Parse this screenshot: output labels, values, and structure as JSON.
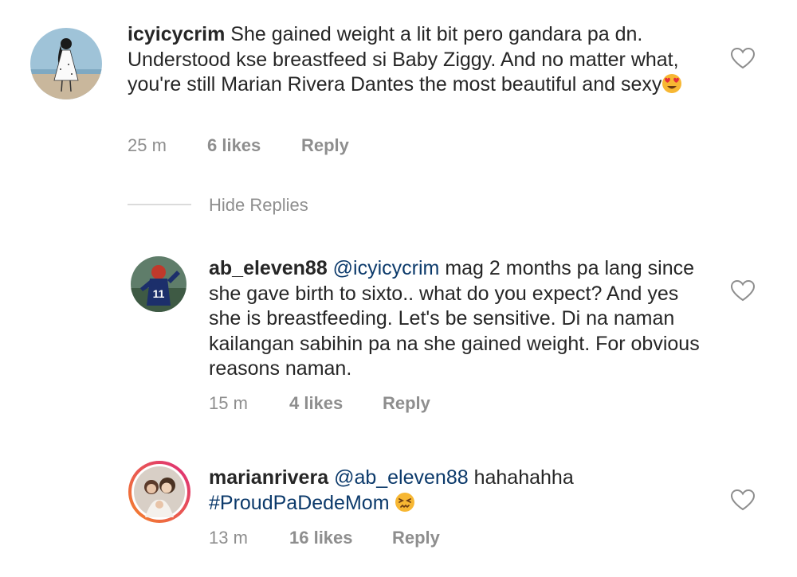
{
  "comments": [
    {
      "username": "icyicycrim",
      "text": "She gained weight a lit bit pero gandara pa dn. Understood kse breastfeed si Baby Ziggy. And no matter what, you're still Marian Rivera Dantes the most beautiful and sexy",
      "emoji": "heart-eyes-emoji",
      "time": "25 m",
      "likes": "6 likes",
      "reply": "Reply"
    }
  ],
  "hide_replies": "Hide Replies",
  "replies": [
    {
      "username": "ab_eleven88",
      "mention": "@icyicycrim",
      "text": "mag 2 months pa lang since she gave birth to sixto.. what do you expect? And yes she is breastfeeding. Let's be sensitive. Di na naman kailangan sabihin pa na she gained weight. For obvious reasons naman.",
      "time": "15 m",
      "likes": "4 likes",
      "reply": "Reply"
    },
    {
      "username": "marianrivera",
      "mention": "@ab_eleven88",
      "text": "hahahahha",
      "hashtag": "#ProudPaDedeMom",
      "emoji": "confounded-face-emoji",
      "time": "13 m",
      "likes": "16 likes",
      "reply": "Reply"
    }
  ],
  "colors": {
    "text": "#262626",
    "meta": "#8e8e8e",
    "link": "#0c3a6b",
    "story_ring_start": "#f58529",
    "story_ring_end": "#dd2a7b"
  }
}
